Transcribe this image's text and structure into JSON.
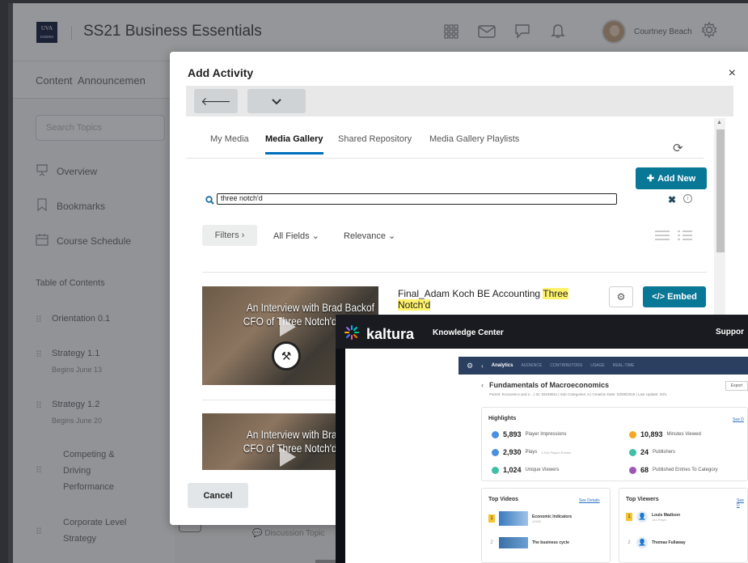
{
  "app": {
    "logo_text": "UVA",
    "logo_sub": "DARDEN",
    "course_title": "SS21 Business Essentials",
    "user_name": "Courtney Beach"
  },
  "subnav": {
    "items": [
      "Content",
      "Announcemen"
    ]
  },
  "sidebar": {
    "search_placeholder": "Search Topics",
    "items": [
      {
        "label": "Overview",
        "icon": "presentation-icon"
      },
      {
        "label": "Bookmarks",
        "icon": "bookmark-icon"
      },
      {
        "label": "Course Schedule",
        "icon": "calendar-icon"
      }
    ],
    "toc_heading": "Table of Contents",
    "toc": [
      {
        "label": "Orientation 0.1",
        "sub": ""
      },
      {
        "label": "Strategy 1.1",
        "sub": "Begins June 13"
      },
      {
        "label": "Strategy 1.2",
        "sub": "Begins June 20"
      },
      {
        "label": "Competing & Driving Performance",
        "sub": ""
      },
      {
        "label": "Corporate Level Strategy",
        "sub": ""
      }
    ]
  },
  "background": {
    "discussion_label": "Discussion Topic"
  },
  "modal": {
    "title": "Add Activity",
    "close": "×",
    "tabs": [
      "My Media",
      "Media Gallery",
      "Shared Repository",
      "Media Gallery Playlists"
    ],
    "active_tab": "Media Gallery",
    "add_new_label": "Add New",
    "search_value": "three notch'd",
    "clear_label": "✖",
    "filters_label": "Filters ›",
    "field_dropdown": "All Fields",
    "sort_dropdown": "Relevance",
    "results": [
      {
        "title_pre": "Final_Adam Koch BE Accounting ",
        "title_hl": "Three Notch'd",
        "thumb_caption_1": "An Interview with Brad Backof",
        "thumb_caption_2": "CFO of Three Notch'd Brewing Com"
      },
      {
        "thumb_caption_1": "An Interview with Brad Backof",
        "thumb_caption_2": "CFO of Three Notch'd Brewing Com"
      }
    ],
    "embed_label": "Embed",
    "cancel_label": "Cancel"
  },
  "kaltura": {
    "logo": "kaltura",
    "header_title": "Knowledge Center",
    "support": "Suppor",
    "nav": {
      "analytics": "Analytics",
      "items": [
        "AUDIENCE",
        "CONTRIBUTORS",
        "USAGE",
        "REAL-TIME"
      ]
    },
    "entry_title": "Fundamentals of Macroeconomics",
    "export": "Export",
    "breadcrumb": "Parent: Economics and s... | ID: 92049911 | Sub Categories: 6 | Creation Date: 03/09/2018 | Last Update: 03/1",
    "highlights_title": "Highlights",
    "see_details": "See D",
    "stats": [
      {
        "value": "5,893",
        "label": "Player Impressions",
        "extra": "",
        "color": "#4a90e2"
      },
      {
        "value": "10,893",
        "label": "Minutes Viewed",
        "extra": "",
        "color": "#f5a623"
      },
      {
        "value": "2,930",
        "label": "Plays",
        "extra": "1,544 Played Entries",
        "color": "#4a90e2"
      },
      {
        "value": "24",
        "label": "Publishers",
        "extra": "",
        "color": "#3fbfa6"
      },
      {
        "value": "1,024",
        "label": "Unique Viewers",
        "extra": "",
        "color": "#3fbfa6"
      },
      {
        "value": "68",
        "label": "Published Entries To Category",
        "extra": "",
        "color": "#9b59b6"
      }
    ],
    "top_videos": {
      "title": "Top Videos",
      "see_details": "See Details",
      "rows": [
        {
          "rank": "1",
          "name": "Economic Indicators",
          "sub": "4/9/30"
        },
        {
          "rank": "2",
          "name": "The business cycle",
          "sub": ""
        }
      ]
    },
    "top_viewers": {
      "title": "Top Viewers",
      "see_details": "See D",
      "rows": [
        {
          "rank": "1",
          "name": "Louis Madison",
          "sub": "144 Plays"
        },
        {
          "rank": "2",
          "name": "Thomas Fullaway",
          "sub": ""
        }
      ]
    }
  }
}
